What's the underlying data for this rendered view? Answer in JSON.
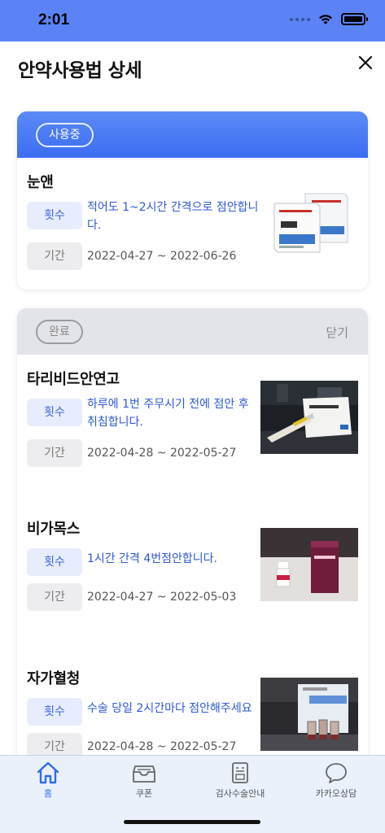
{
  "status": {
    "time": "2:01"
  },
  "header": {
    "title": "안약사용법 상세"
  },
  "active_section": {
    "badge": "사용중",
    "items": [
      {
        "name": "눈앤",
        "count_label": "횟수",
        "instruction_line1": "적어도 1~2시간 간격으로 점안합니",
        "instruction_line2": "다.",
        "period_label": "기간",
        "period": "2022-04-27 ~ 2022-06-26"
      }
    ]
  },
  "done_section": {
    "badge": "완료",
    "collapse_label": "닫기",
    "items": [
      {
        "name": "타리비드안연고",
        "count_label": "횟수",
        "instruction_line1": "하루에 1번 주무시기 전에 점안 후",
        "instruction_line2": "취침합니다.",
        "period_label": "기간",
        "period": "2022-04-28 ~ 2022-05-27"
      },
      {
        "name": "비가목스",
        "count_label": "횟수",
        "instruction_line1": "1시간 간격 4번점안합니다.",
        "instruction_line2": "",
        "period_label": "기간",
        "period": "2022-04-27 ~ 2022-05-03"
      },
      {
        "name": "자가혈청",
        "count_label": "횟수",
        "instruction_line1": "수술 당일 2시간마다 점안해주세요",
        "instruction_line2": "",
        "period_label": "기간",
        "period": "2022-04-28 ~ 2022-05-27"
      }
    ]
  },
  "tabbar": {
    "tabs": [
      {
        "label": "홈",
        "icon": "home-icon",
        "active": true
      },
      {
        "label": "쿠폰",
        "icon": "coupon-box-icon",
        "active": false
      },
      {
        "label": "검사수술안내",
        "icon": "document-icon",
        "active": false
      },
      {
        "label": "카카오상담",
        "icon": "chat-bubble-icon",
        "active": false
      }
    ]
  },
  "colors": {
    "accent": "#3c6df2",
    "status_bar": "#5b83f5",
    "instruction_text": "#2e58d6"
  }
}
